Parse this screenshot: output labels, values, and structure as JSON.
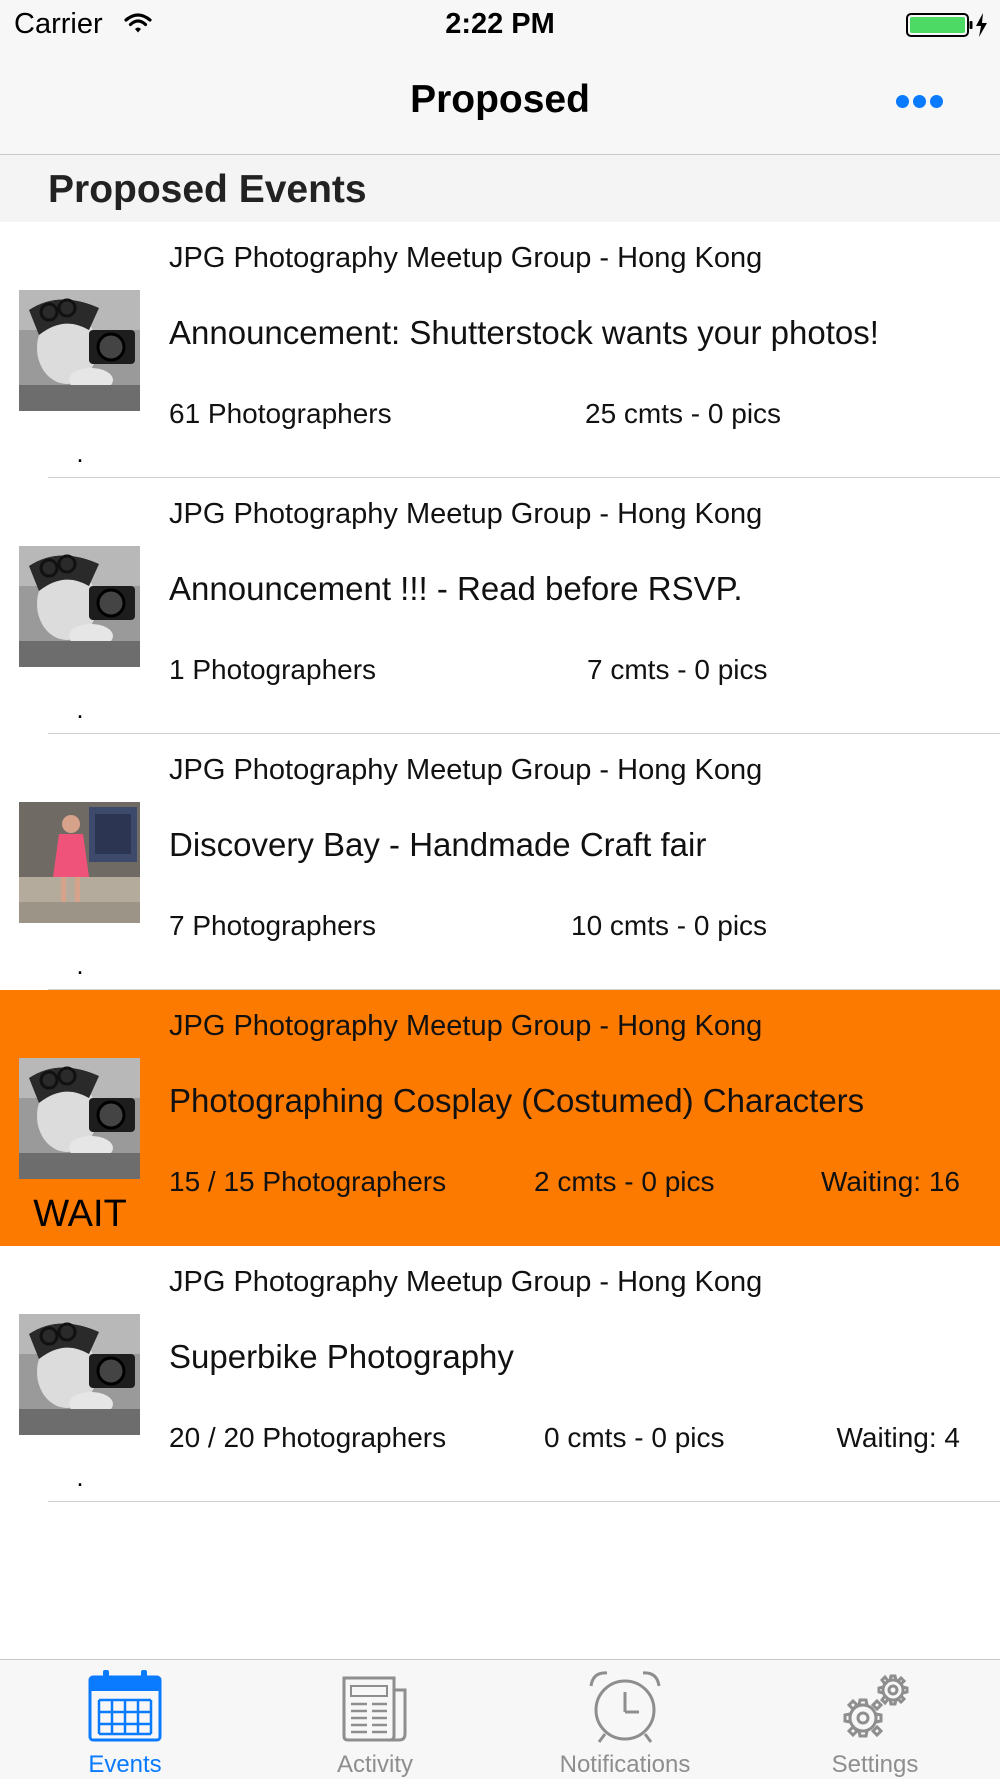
{
  "status_bar": {
    "carrier": "Carrier",
    "time": "2:22 PM",
    "battery_color": "#4cd964"
  },
  "nav": {
    "title": "Proposed",
    "more_icon": "more-ellipsis-icon",
    "accent_color": "#0a7aff"
  },
  "section": {
    "title": "Proposed Events"
  },
  "events": [
    {
      "group": "JPG Photography Meetup Group - Hong Kong",
      "title": "Announcement: Shutterstock wants your photos!",
      "photographers": "61 Photographers",
      "comments": "25 cmts - 0 pics",
      "waiting": "",
      "status": ".",
      "thumbnail": "portrait-with-camera",
      "highlighted": false
    },
    {
      "group": "JPG Photography Meetup Group - Hong Kong",
      "title": "Announcement !!! - Read before RSVP.",
      "photographers": "1 Photographers",
      "comments": "7 cmts - 0 pics",
      "waiting": "",
      "status": ".",
      "thumbnail": "portrait-with-camera",
      "highlighted": false
    },
    {
      "group": "JPG Photography Meetup Group - Hong Kong",
      "title": "Discovery Bay - Handmade Craft fair",
      "photographers": "7 Photographers",
      "comments": "10 cmts - 0 pics",
      "waiting": "",
      "status": ".",
      "thumbnail": "woman-in-pink-dress",
      "highlighted": false
    },
    {
      "group": "JPG Photography Meetup Group - Hong Kong",
      "title": "Photographing Cosplay (Costumed) Characters",
      "photographers": "15 / 15 Photographers",
      "comments": "2 cmts - 0 pics",
      "waiting": "Waiting: 16",
      "status": "WAIT",
      "thumbnail": "portrait-with-camera",
      "highlighted": true,
      "highlight_color": "#fd7a00"
    },
    {
      "group": "JPG Photography Meetup Group - Hong Kong",
      "title": "Superbike Photography",
      "photographers": "20 / 20 Photographers",
      "comments": "0 cmts - 0 pics",
      "waiting": "Waiting: 4",
      "status": ".",
      "thumbnail": "portrait-with-camera",
      "highlighted": false
    }
  ],
  "tabs": [
    {
      "label": "Events",
      "icon": "calendar-icon",
      "active": true
    },
    {
      "label": "Activity",
      "icon": "newspaper-icon",
      "active": false
    },
    {
      "label": "Notifications",
      "icon": "alarm-clock-icon",
      "active": false
    },
    {
      "label": "Settings",
      "icon": "gears-icon",
      "active": false
    }
  ]
}
